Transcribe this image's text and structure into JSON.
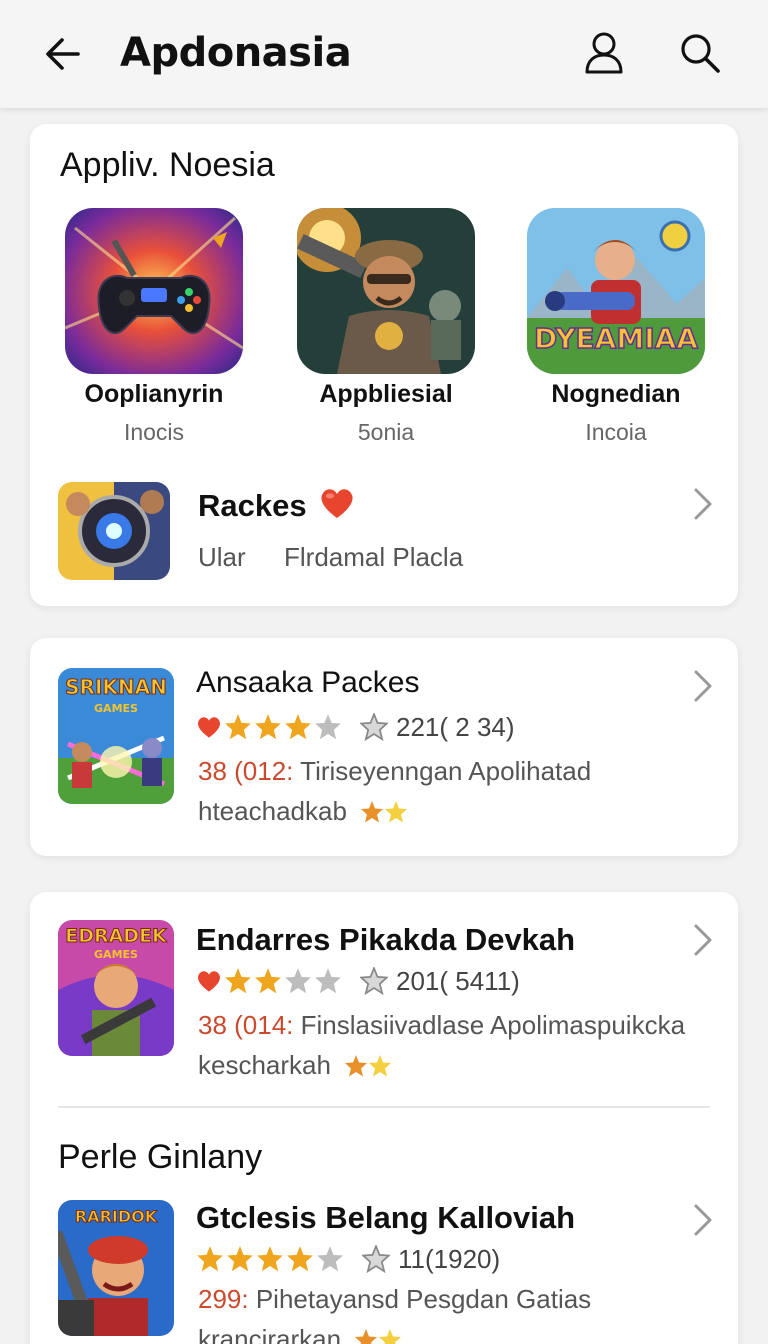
{
  "header": {
    "title": "Apdonasia",
    "back_icon": "arrow-left-icon",
    "user_icon": "user-icon",
    "search_icon": "search-icon"
  },
  "section1": {
    "title": "Appliv. Noesia",
    "featured": [
      {
        "name": "Ooplianyrin",
        "sub": "Inocis"
      },
      {
        "name": "Appbliesial",
        "sub": "5onia"
      },
      {
        "name": "Nognedian",
        "sub": "Incoia",
        "art_text": "DYEAMIAA"
      }
    ],
    "row": {
      "name": "Rackes",
      "meta1": "Ular",
      "meta2": "Flrdamal Placla"
    }
  },
  "card2": {
    "name": "Ansaaka Packes",
    "art_text": "SRIKNAN",
    "art_sub": "GAMES",
    "rating": 3.5,
    "count": "221( 2 34)",
    "desc_hl": "38 (012:",
    "desc": "Tiriseyenngan Apolihatad",
    "desc2": "hteachadkab"
  },
  "card3": {
    "item1": {
      "name": "Endarres Pikakda Devkah",
      "art_text": "EDRADEK",
      "art_sub": "GAMES",
      "rating": 2.5,
      "count": "201( 5411)",
      "desc_hl": "38 (014:",
      "desc": "Finslasiivadlase Apolimaspuikcka",
      "desc2": "kescharkah"
    },
    "section_title": "Perle Ginlany",
    "item2": {
      "name": "Gtclesis Belang Kalloviah",
      "art_text": "RARIDOK",
      "rating": 3.5,
      "count": "11(1920)",
      "desc_hl": "299:",
      "desc": "Pihetayansd Pesgdan Gatias",
      "desc2": "krancirarkan"
    }
  },
  "colors": {
    "accent_heart": "#e8452f",
    "star": "#f0a51e",
    "star_empty": "#bdbdbd",
    "highlight_text": "#c94a2c"
  }
}
